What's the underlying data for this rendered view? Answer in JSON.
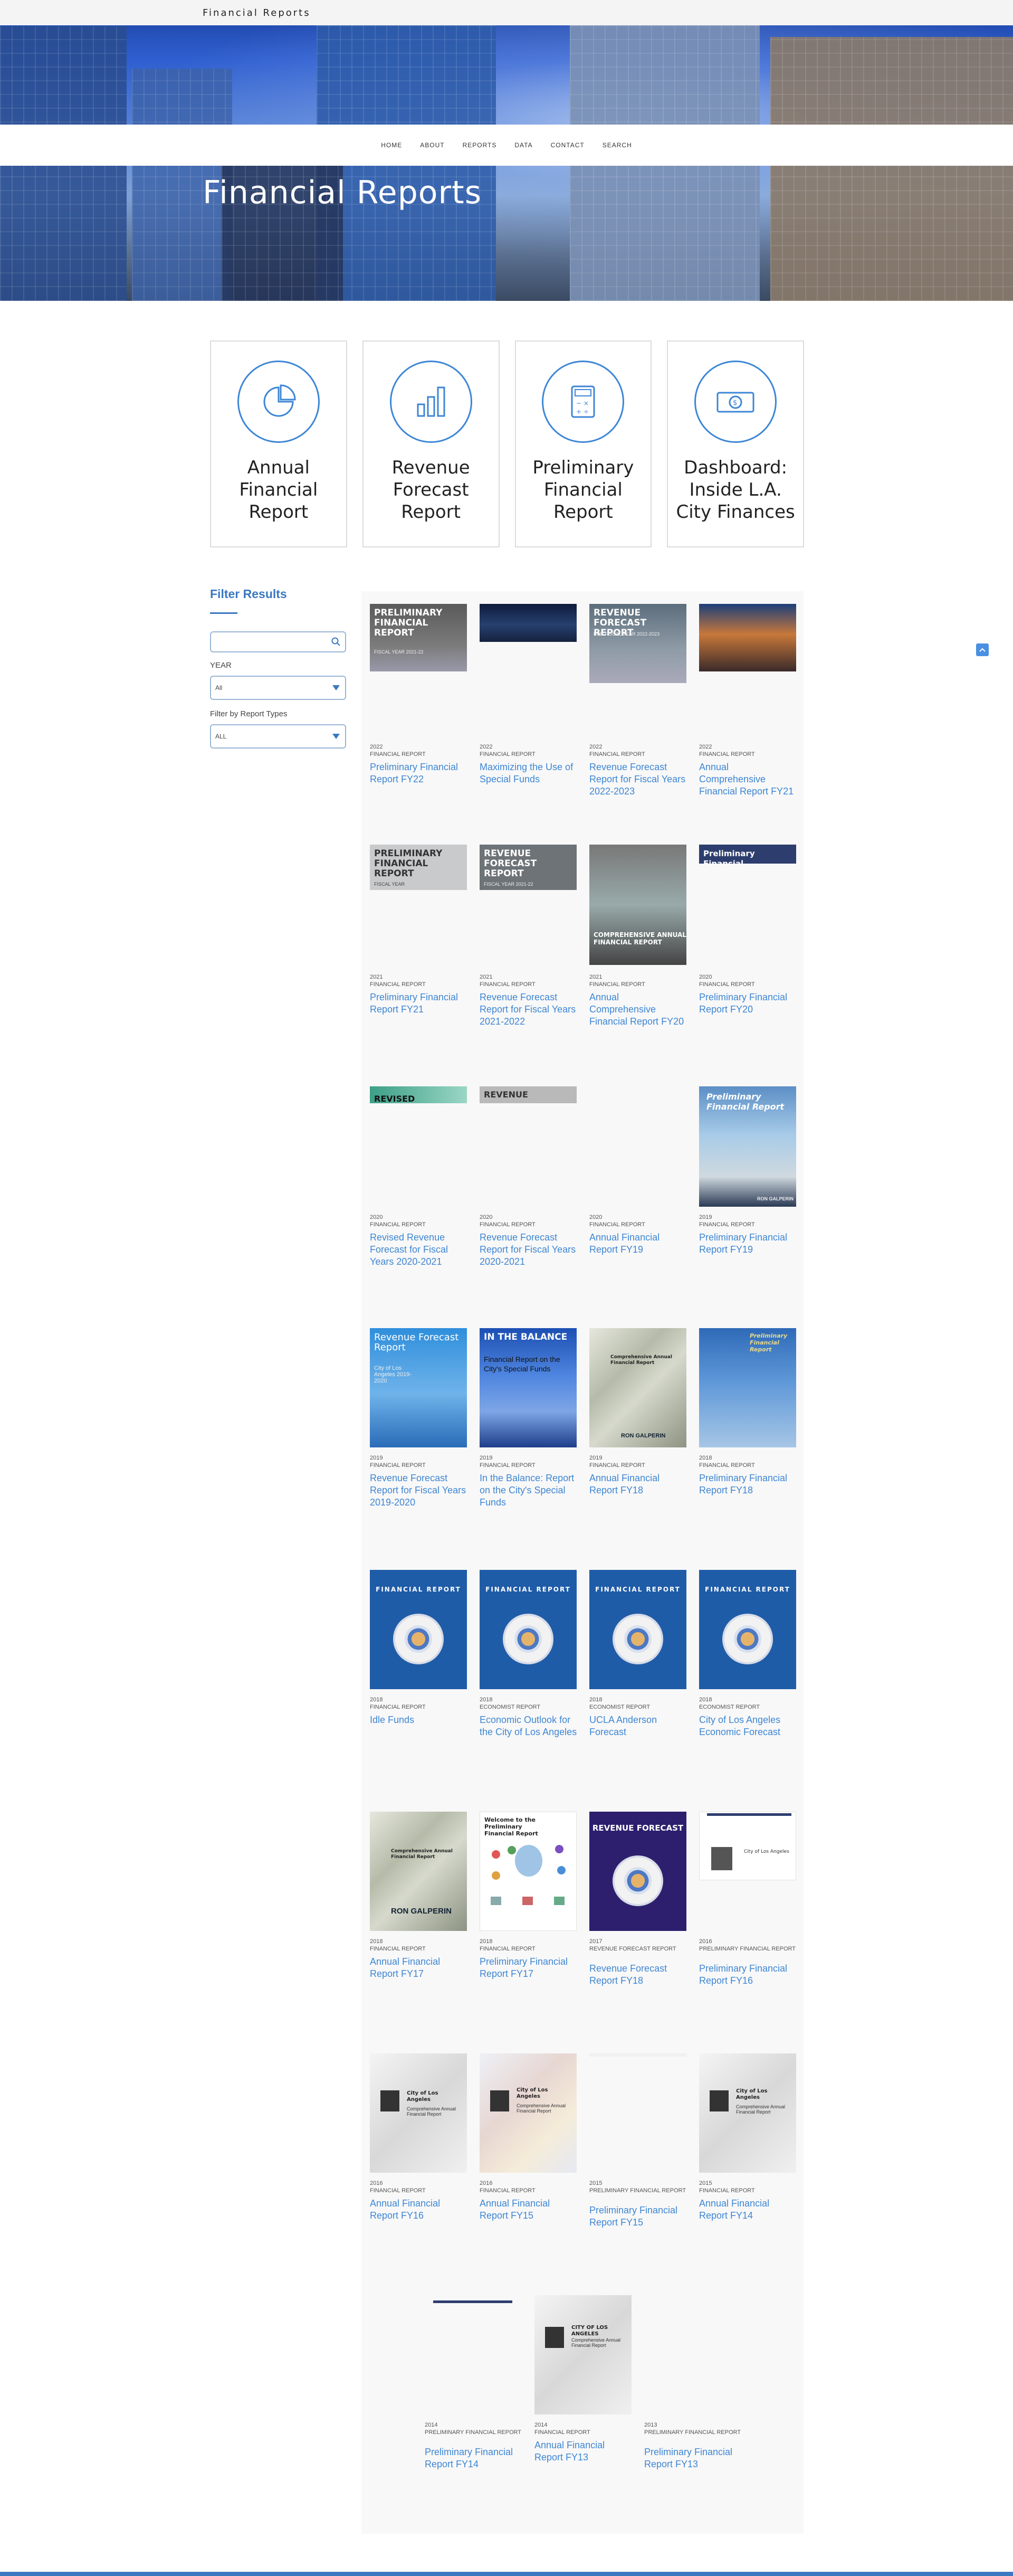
{
  "header": {
    "site_name": "Financial Reports",
    "title": "Financial Reports",
    "nav": [
      "HOME",
      "ABOUT",
      "REPORTS",
      "DATA",
      "CONTACT",
      "SEARCH"
    ]
  },
  "categories": [
    {
      "label": "Annual Financial Report",
      "icon": "pie-chart-icon"
    },
    {
      "label": "Revenue Forecast Report",
      "icon": "bar-chart-icon"
    },
    {
      "label": "Preliminary Financial Report",
      "icon": "calculator-icon"
    },
    {
      "label": "Dashboard: Inside L.A. City Finances",
      "icon": "money-bill-icon"
    }
  ],
  "sidebar": {
    "title": "Filter Results",
    "search_placeholder": "",
    "year_label": "YEAR",
    "year_value": "All",
    "type_label": "Filter by Report Types",
    "type_value": "ALL"
  },
  "reports": [
    {
      "year": "2022",
      "type": "FINANCIAL REPORT",
      "title": "Preliminary Financial Report FY22",
      "thumb_text": "PRELIMINARY FINANCIAL REPORT",
      "thumb_sub": "FISCAL YEAR 2021-22"
    },
    {
      "year": "2022",
      "type": "FINANCIAL REPORT",
      "title": "Maximizing the Use of Special Funds",
      "thumb_text": "",
      "thumb_sub": ""
    },
    {
      "year": "2022",
      "type": "FINANCIAL REPORT",
      "title": "Revenue Forecast Report for Fiscal Years 2022-2023",
      "thumb_text": "REVENUE FORECAST REPORT",
      "thumb_sub": "FOR FISCAL YEAR 2022-2023"
    },
    {
      "year": "2022",
      "type": "FINANCIAL REPORT",
      "title": "Annual Comprehensive Financial Report FY21",
      "thumb_text": "",
      "thumb_sub": ""
    },
    {
      "year": "2021",
      "type": "FINANCIAL REPORT",
      "title": "Preliminary Financial Report FY21",
      "thumb_text": "PRELIMINARY FINANCIAL REPORT",
      "thumb_sub": "FISCAL YEAR"
    },
    {
      "year": "2021",
      "type": "FINANCIAL REPORT",
      "title": "Revenue Forecast Report for Fiscal Years 2021-2022",
      "thumb_text": "REVENUE FORECAST REPORT",
      "thumb_sub": "FISCAL YEAR 2021-22"
    },
    {
      "year": "2021",
      "type": "FINANCIAL REPORT",
      "title": "Annual Comprehensive Financial Report FY20",
      "thumb_text": "COMPREHENSIVE ANNUAL FINANCIAL REPORT",
      "thumb_sub": ""
    },
    {
      "year": "2020",
      "type": "FINANCIAL REPORT",
      "title": "Preliminary Financial Report FY20",
      "thumb_text": "Preliminary Financial",
      "thumb_sub": ""
    },
    {
      "year": "2020",
      "type": "FINANCIAL REPORT",
      "title": "Revised Revenue Forecast for Fiscal Years 2020-2021",
      "thumb_text": "REVISED",
      "thumb_sub": ""
    },
    {
      "year": "2020",
      "type": "FINANCIAL REPORT",
      "title": "Revenue Forecast Report for Fiscal Years 2020-2021",
      "thumb_text": "REVENUE",
      "thumb_sub": ""
    },
    {
      "year": "2020",
      "type": "FINANCIAL REPORT",
      "title": "Annual Financial Report FY19",
      "thumb_text": "",
      "thumb_sub": ""
    },
    {
      "year": "2019",
      "type": "FINANCIAL REPORT",
      "title": "Preliminary Financial Report FY19",
      "thumb_text": "Preliminary Financial Report",
      "thumb_sub": "RON GALPERIN"
    },
    {
      "year": "2019",
      "type": "FINANCIAL REPORT",
      "title": "Revenue Forecast Report for Fiscal Years 2019-2020",
      "thumb_text": "Revenue Forecast Report",
      "thumb_sub": "City of Los Angeles 2019-2020"
    },
    {
      "year": "2019",
      "type": "FINANCIAL REPORT",
      "title": "In the Balance: Report on the City's Special Funds",
      "thumb_text": "IN THE BALANCE",
      "thumb_sub": "Financial Report on the City's Special Funds"
    },
    {
      "year": "2019",
      "type": "FINANCIAL REPORT",
      "title": "Annual Financial Report FY18",
      "thumb_text": "Comprehensive Annual Financial Report",
      "thumb_sub": "RON GALPERIN"
    },
    {
      "year": "2018",
      "type": "FINANCIAL REPORT",
      "title": "Preliminary Financial Report FY18",
      "thumb_text": "Preliminary Financial Report",
      "thumb_sub": ""
    },
    {
      "year": "2018",
      "type": "FINANCIAL REPORT",
      "title": "Idle Funds",
      "thumb_text": "FINANCIAL REPORT",
      "thumb_sub": ""
    },
    {
      "year": "2018",
      "type": "ECONOMIST REPORT",
      "title": "Economic Outlook for the City of Los Angeles",
      "thumb_text": "FINANCIAL REPORT",
      "thumb_sub": ""
    },
    {
      "year": "2018",
      "type": "ECONOMIST REPORT",
      "title": "UCLA Anderson Forecast",
      "thumb_text": "FINANCIAL REPORT",
      "thumb_sub": ""
    },
    {
      "year": "2018",
      "type": "ECONOMIST REPORT",
      "title": "City of Los Angeles Economic Forecast",
      "thumb_text": "FINANCIAL REPORT",
      "thumb_sub": ""
    },
    {
      "year": "2018",
      "type": "FINANCIAL REPORT",
      "title": "Annual Financial Report FY17",
      "thumb_text": "Comprehensive Annual Financial Report",
      "thumb_sub": "RON GALPERIN"
    },
    {
      "year": "2018",
      "type": "FINANCIAL REPORT",
      "title": "Preliminary Financial Report FY17",
      "thumb_text": "Welcome to the Preliminary Financial Report",
      "thumb_sub": ""
    },
    {
      "year": "2017",
      "type": "REVENUE FORECAST REPORT",
      "title": "Revenue Forecast Report FY18",
      "thumb_text": "REVENUE FORECAST",
      "thumb_sub": ""
    },
    {
      "year": "2016",
      "type": "PRELIMINARY FINANCIAL REPORT",
      "title": "Preliminary Financial Report FY16",
      "thumb_text": "City of Los Angeles",
      "thumb_sub": ""
    },
    {
      "year": "2016",
      "type": "FINANCIAL REPORT",
      "title": "Annual Financial Report FY16",
      "thumb_text": "City of Los Angeles",
      "thumb_sub": "Comprehensive Annual Financial Report"
    },
    {
      "year": "2016",
      "type": "FINANCIAL REPORT",
      "title": "Annual Financial Report FY15",
      "thumb_text": "City of Los Angeles",
      "thumb_sub": "Comprehensive Annual Financial Report"
    },
    {
      "year": "2015",
      "type": "PRELIMINARY FINANCIAL REPORT",
      "title": "Preliminary Financial Report FY15",
      "thumb_text": "",
      "thumb_sub": ""
    },
    {
      "year": "2015",
      "type": "FINANCIAL REPORT",
      "title": "Annual Financial Report FY14",
      "thumb_text": "City of Los Angeles",
      "thumb_sub": "Comprehensive Annual Financial Report"
    },
    {
      "year": "2014",
      "type": "PRELIMINARY FINANCIAL REPORT",
      "title": "Preliminary Financial Report FY14",
      "thumb_text": "",
      "thumb_sub": ""
    },
    {
      "year": "2014",
      "type": "FINANCIAL REPORT",
      "title": "Annual Financial Report FY13",
      "thumb_text": "CITY OF LOS ANGELES",
      "thumb_sub": "Comprehensive Annual Financial Report"
    },
    {
      "year": "2013",
      "type": "PRELIMINARY FINANCIAL REPORT",
      "title": "Preliminary Financial Report FY13",
      "thumb_text": "",
      "thumb_sub": ""
    }
  ],
  "colors": {
    "accent": "#3e86d3",
    "hero": "#2f5fd0",
    "panel": "#f8f8f8"
  }
}
